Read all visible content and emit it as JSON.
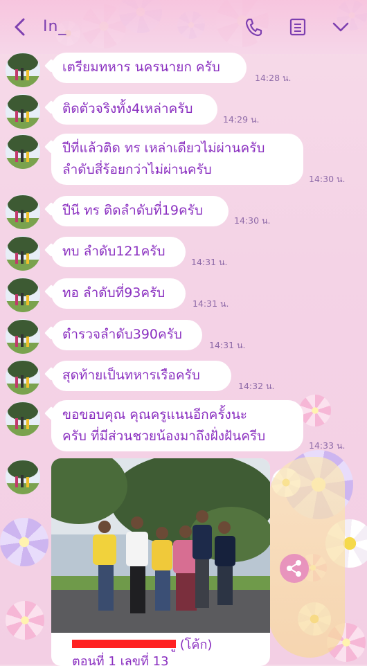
{
  "header": {
    "title": "In_",
    "icons": [
      "chevron-left-icon",
      "phone-icon",
      "menu-icon",
      "chevron-down-icon"
    ]
  },
  "messages": [
    {
      "text": "เตรียมทหาร นครนายก ครับ",
      "time": "14:28 น."
    },
    {
      "text": "ติดตัวจริงทั้ง4เหล่าครับ",
      "time": "14:29 น."
    },
    {
      "text": "ปีที่แล้วติด ทร เหล่าเดียวไม่ผ่านครับ\nลำดับสี่ร้อยกว่าไม่ผ่านครับ",
      "time": "14:30 น."
    },
    {
      "text": "ปีนี ทร ติดลำดับที่19ครับ",
      "time": "14:30 น."
    },
    {
      "text": "ทบ ลำดับ121ครับ",
      "time": "14:31 น."
    },
    {
      "text": "ทอ ลำดับที่93ครับ",
      "time": "14:31 น."
    },
    {
      "text": "ตำรวจลำดับ390ครับ",
      "time": "14:31 น."
    },
    {
      "text": "สุดท้ายเป็นทหารเรือครับ",
      "time": "14:32 น."
    },
    {
      "text": "ขอขอบคุณ คุณครูแนนอีกครั้งนะ\nครับ ที่มีส่วนชวยน้องมาถึงฝั่งฝันครีบ",
      "time": "14:33 น."
    }
  ],
  "photo_message": {
    "caption_line1": "ู (โค้ก)",
    "caption_line2": "ตอนที่ 1 เลขที่ 13"
  },
  "colors": {
    "accent": "#8a2fc0",
    "header_icon": "#7d3fb0",
    "time": "#8e6aa8",
    "redaction": "#ff2222"
  }
}
